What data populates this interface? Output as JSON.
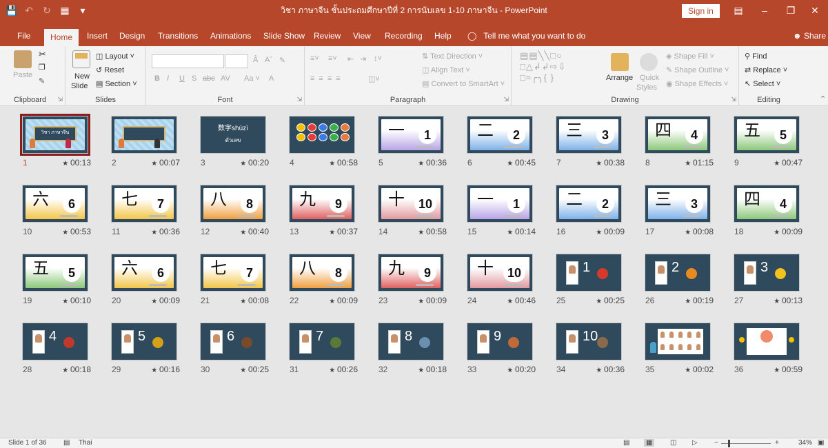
{
  "titlebar": {
    "title": "วิชา ภาษาจีน ชั้นประถมศึกษาปีที่ 2 การนับเลข 1-10 ภาษาจีน  -  PowerPoint",
    "sign_in": "Sign in"
  },
  "tabs": [
    "File",
    "Home",
    "Insert",
    "Design",
    "Transitions",
    "Animations",
    "Slide Show",
    "Review",
    "View",
    "Recording",
    "Help"
  ],
  "active_tab": "Home",
  "tell_me": "Tell me what you want to do",
  "share": "Share",
  "ribbon": {
    "clipboard": {
      "paste": "Paste",
      "label": "Clipboard"
    },
    "slides": {
      "new_slide_1": "New",
      "new_slide_2": "Slide",
      "layout": "Layout",
      "reset": "Reset",
      "section": "Section",
      "label": "Slides"
    },
    "font": {
      "font_name": "",
      "font_size": "",
      "label": "Font",
      "aa": "Aa"
    },
    "paragraph": {
      "text_direction": "Text Direction",
      "align_text": "Align Text",
      "convert_smartart": "Convert to SmartArt",
      "label": "Paragraph"
    },
    "drawing": {
      "arrange": "Arrange",
      "quick_styles_1": "Quick",
      "quick_styles_2": "Styles",
      "shape_fill": "Shape Fill",
      "shape_outline": "Shape Outline",
      "shape_effects": "Shape Effects",
      "label": "Drawing"
    },
    "editing": {
      "find": "Find",
      "replace": "Replace",
      "select": "Select",
      "label": "Editing"
    }
  },
  "slides": [
    {
      "n": "1",
      "time": "00:13"
    },
    {
      "n": "2",
      "time": "00:07"
    },
    {
      "n": "3",
      "time": "00:20"
    },
    {
      "n": "4",
      "time": "00:58"
    },
    {
      "n": "5",
      "time": "00:36"
    },
    {
      "n": "6",
      "time": "00:45"
    },
    {
      "n": "7",
      "time": "00:38"
    },
    {
      "n": "8",
      "time": "01:15"
    },
    {
      "n": "9",
      "time": "00:47"
    },
    {
      "n": "10",
      "time": "00:53"
    },
    {
      "n": "11",
      "time": "00:36"
    },
    {
      "n": "12",
      "time": "00:40"
    },
    {
      "n": "13",
      "time": "00:37"
    },
    {
      "n": "14",
      "time": "00:58"
    },
    {
      "n": "15",
      "time": "00:14"
    },
    {
      "n": "16",
      "time": "00:09"
    },
    {
      "n": "17",
      "time": "00:08"
    },
    {
      "n": "18",
      "time": "00:09"
    },
    {
      "n": "19",
      "time": "00:10"
    },
    {
      "n": "20",
      "time": "00:09"
    },
    {
      "n": "21",
      "time": "00:08"
    },
    {
      "n": "22",
      "time": "00:09"
    },
    {
      "n": "23",
      "time": "00:09"
    },
    {
      "n": "24",
      "time": "00:46"
    },
    {
      "n": "25",
      "time": "00:25"
    },
    {
      "n": "26",
      "time": "00:19"
    },
    {
      "n": "27",
      "time": "00:13"
    },
    {
      "n": "28",
      "time": "00:18"
    },
    {
      "n": "29",
      "time": "00:16"
    },
    {
      "n": "30",
      "time": "00:25"
    },
    {
      "n": "31",
      "time": "00:26"
    },
    {
      "n": "32",
      "time": "00:18"
    },
    {
      "n": "33",
      "time": "00:20"
    },
    {
      "n": "34",
      "time": "00:36"
    },
    {
      "n": "35",
      "time": "00:02"
    },
    {
      "n": "36",
      "time": "00:59"
    }
  ],
  "slide_content": {
    "s1_title": "วิชา ภาษาจีน",
    "s3_title": "数字shùzì",
    "s3_sub": "ตัวเลข",
    "han": [
      "一",
      "二",
      "三",
      "四",
      "五",
      "六",
      "七",
      "八",
      "九",
      "十"
    ],
    "digits": [
      "1",
      "2",
      "3",
      "4",
      "5",
      "6",
      "7",
      "8",
      "9",
      "10"
    ]
  },
  "status": {
    "slide_of": "Slide 1 of 36",
    "language": "Thai",
    "zoom": "34%",
    "zoom_plus": "+",
    "zoom_minus": "−"
  },
  "colors": {
    "accent": "#b7472a",
    "slide_frame": "#2e4a5c",
    "selected_outline": "#8b1c1c"
  }
}
